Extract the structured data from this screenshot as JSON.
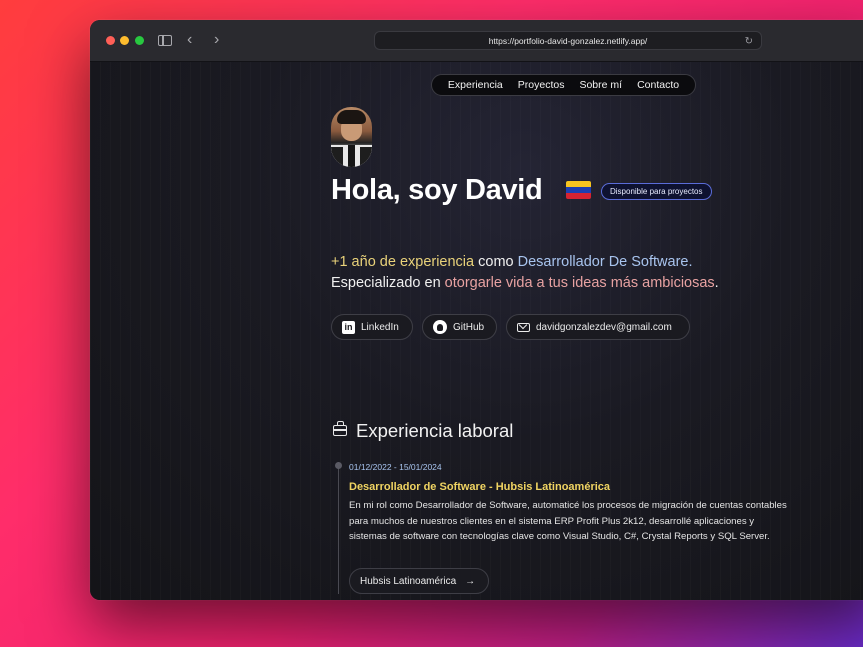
{
  "browser": {
    "url": "https://portfolio-david-gonzalez.netlify.app/"
  },
  "nav": {
    "items": [
      "Experiencia",
      "Proyectos",
      "Sobre mí",
      "Contacto"
    ]
  },
  "hero": {
    "greeting": "Hola, soy David",
    "badge": "Disponible para proyectos",
    "intro": {
      "experience": "+1 año de experiencia",
      "como": " como ",
      "role": "Desarrollador De Software.",
      "especializado": "Especializado en ",
      "highlight": "otorgarle vida a tus ideas más ambiciosas",
      "period": "."
    },
    "links": {
      "linkedin": "LinkedIn",
      "github": "GitHub",
      "email": "davidgonzalezdev@gmail.com"
    }
  },
  "experience": {
    "title": "Experiencia laboral",
    "items": [
      {
        "date": "01/12/2022 - 15/01/2024",
        "title": "Desarrollador de Software - Hubsis Latinoamérica",
        "description": "En mi rol como Desarrollador de Software, automaticé los procesos de migración de cuentas contables para muchos de nuestros clientes en el sistema ERP Profit Plus 2k12, desarrollé aplicaciones y sistemas de software con tecnologías clave como Visual Studio, C#, Crystal Reports y SQL Server.",
        "company": "Hubsis Latinoamérica"
      }
    ]
  },
  "colors": {
    "accent_yellow": "#e9d27a",
    "accent_blue": "#a8c4ee",
    "accent_pink": "#e8a2a2",
    "job_title": "#f0d462"
  }
}
